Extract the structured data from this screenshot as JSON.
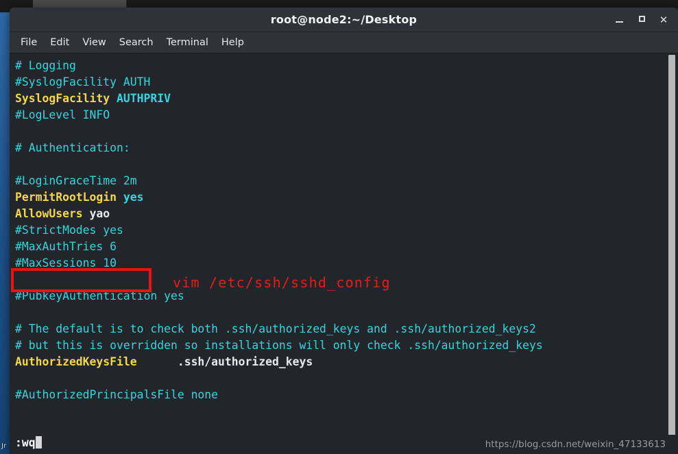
{
  "desktop": {
    "icon_labels": [
      "Jr"
    ]
  },
  "window": {
    "title": "root@node2:~/Desktop",
    "controls": {
      "minimize": "_",
      "maximize": "□",
      "close": "✕"
    }
  },
  "menubar": {
    "items": [
      {
        "label": "File"
      },
      {
        "label": "Edit"
      },
      {
        "label": "View"
      },
      {
        "label": "Search"
      },
      {
        "label": "Terminal"
      },
      {
        "label": "Help"
      }
    ]
  },
  "editor": {
    "lines": [
      {
        "segments": [
          {
            "text": "# Logging",
            "style": "comment"
          }
        ]
      },
      {
        "segments": [
          {
            "text": "#SyslogFacility AUTH",
            "style": "comment"
          }
        ]
      },
      {
        "segments": [
          {
            "text": "SyslogFacility ",
            "style": "key"
          },
          {
            "text": "AUTHPRIV",
            "style": "val"
          }
        ]
      },
      {
        "segments": [
          {
            "text": "#LogLevel INFO",
            "style": "comment"
          }
        ]
      },
      {
        "segments": [
          {
            "text": "",
            "style": "comment"
          }
        ]
      },
      {
        "segments": [
          {
            "text": "# Authentication:",
            "style": "comment"
          }
        ]
      },
      {
        "segments": [
          {
            "text": "",
            "style": "comment"
          }
        ]
      },
      {
        "segments": [
          {
            "text": "#LoginGraceTime 2m",
            "style": "comment"
          }
        ]
      },
      {
        "segments": [
          {
            "text": "PermitRootLogin ",
            "style": "key"
          },
          {
            "text": "yes",
            "style": "val"
          }
        ]
      },
      {
        "segments": [
          {
            "text": "AllowUsers ",
            "style": "key"
          },
          {
            "text": "yao",
            "style": "plain"
          }
        ]
      },
      {
        "segments": [
          {
            "text": "#StrictModes yes",
            "style": "comment"
          }
        ]
      },
      {
        "segments": [
          {
            "text": "#MaxAuthTries 6",
            "style": "comment"
          }
        ]
      },
      {
        "segments": [
          {
            "text": "#MaxSessions 10",
            "style": "comment"
          }
        ]
      },
      {
        "segments": [
          {
            "text": "",
            "style": "comment"
          }
        ]
      },
      {
        "segments": [
          {
            "text": "#PubkeyAuthentication yes",
            "style": "comment"
          }
        ]
      },
      {
        "segments": [
          {
            "text": "",
            "style": "comment"
          }
        ]
      },
      {
        "segments": [
          {
            "text": "# The default is to check both .ssh/authorized_keys and .ssh/authorized_keys2",
            "style": "comment"
          }
        ]
      },
      {
        "segments": [
          {
            "text": "# but this is overridden so installations will only check .ssh/authorized_keys",
            "style": "comment"
          }
        ]
      },
      {
        "segments": [
          {
            "text": "AuthorizedKeysFile",
            "style": "key"
          },
          {
            "text": "      .ssh/authorized_keys",
            "style": "plain"
          }
        ]
      },
      {
        "segments": [
          {
            "text": "",
            "style": "comment"
          }
        ]
      },
      {
        "segments": [
          {
            "text": "#AuthorizedPrincipalsFile none",
            "style": "comment"
          }
        ]
      }
    ],
    "command_line": ":wq"
  },
  "annotations": {
    "highlight_target": "AllowUsers yao",
    "note_text": "vim /etc/ssh/sshd_config",
    "note_color": "#e81c1c",
    "box_color": "#ee1111"
  },
  "watermark": {
    "text": "https://blog.csdn.net/weixin_47133613"
  },
  "colors": {
    "terminal_background": "#22262a",
    "titlebar": "#2f3337",
    "comment": "#33d6e0",
    "keyword": "#f2d64b",
    "value": "#33d6e0",
    "plain": "#e8e8e8",
    "desktop": "#1b4f8a"
  }
}
